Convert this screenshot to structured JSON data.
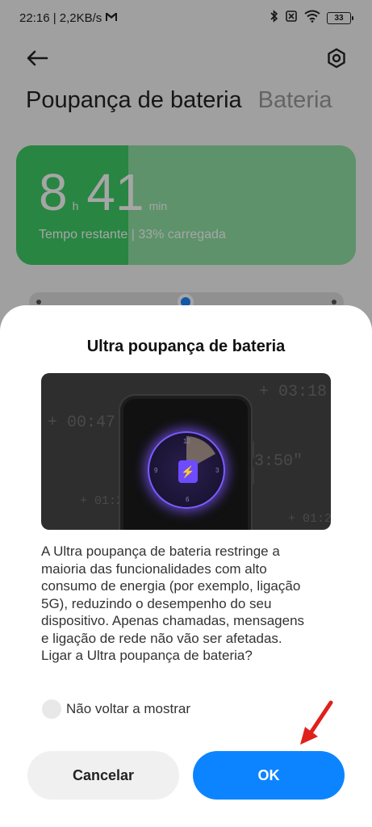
{
  "status_bar": {
    "time_speed": "22:16 | 2,2KB/s",
    "mail_icon": "gmail-icon",
    "battery_level": "33",
    "icons": [
      "bluetooth-icon",
      "no-sim-icon",
      "wifi-icon",
      "battery-icon"
    ]
  },
  "header": {
    "back_icon": "back-arrow-icon",
    "settings_icon": "settings-icon",
    "title": "Poupança de bateria",
    "second_tab": "Bateria"
  },
  "battery_card": {
    "hours": "8",
    "hours_unit": "h",
    "minutes": "41",
    "minutes_unit": "min",
    "subtitle": "Tempo restante | 33% carregada",
    "charge_fraction": 0.33
  },
  "dialog": {
    "title": "Ultra poupança de bateria",
    "illustration": {
      "ghost_timers": [
        "+ 03:18",
        "+ 00:47",
        "3:50\"",
        "+ 01:2",
        "+ 01:2"
      ],
      "clock_numbers": [
        "12",
        "3",
        "6",
        "9"
      ],
      "icon": "battery-bolt-icon"
    },
    "description": "A Ultra poupança de bateria restringe a maioria das funcionalidades com alto consumo de energia (por exemplo, ligação 5G), reduzindo o desempenho do seu dispositivo. Apenas chamadas, mensagens e ligação de rede não vão ser afetadas. Ligar a Ultra poupança de bateria?",
    "dont_show_label": "Não voltar a mostrar",
    "cancel_label": "Cancelar",
    "ok_label": "OK"
  },
  "colors": {
    "accent_blue": "#0d84ff",
    "battery_green": "#3fcc66",
    "arrow_red": "#e0201c"
  }
}
